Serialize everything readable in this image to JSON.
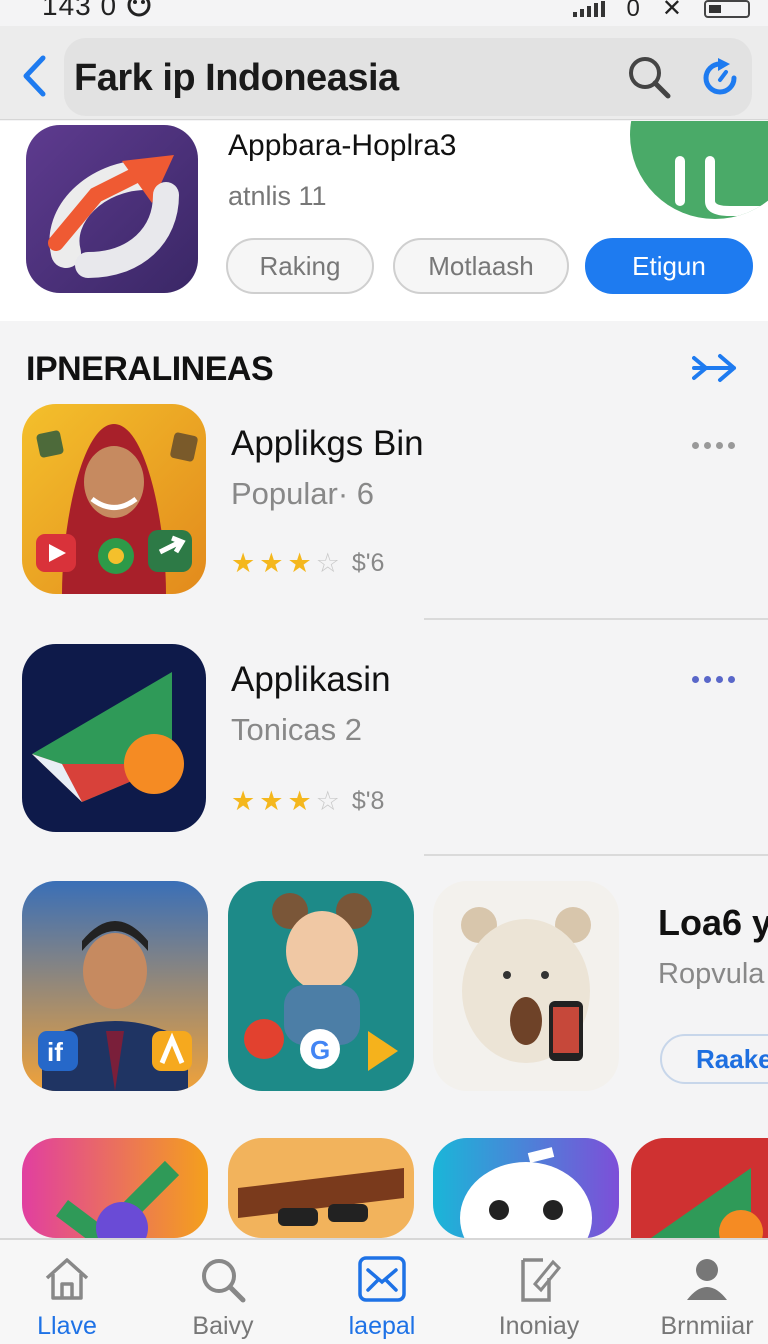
{
  "status_bar": {
    "time": "143 0",
    "carrier_icon": "face-icon",
    "network_text": "0"
  },
  "nav": {
    "title": "Fark ip Indoneasia",
    "back_icon": "chevron-left-icon",
    "search_icon": "search-icon",
    "update_icon": "refresh-icon"
  },
  "featured": {
    "name": "Appbara-Hoplra3",
    "subtitle": "atnlis 11",
    "buttons": [
      "Raking",
      "Motlaash",
      "Etigun"
    ]
  },
  "section": {
    "title": "IPNERALINEAS",
    "arrow_icon": "arrow-right-icon"
  },
  "apps": [
    {
      "name": "Applikgs Bin",
      "subtitle": "Popular· 6",
      "rating": 3,
      "price": "$'6"
    },
    {
      "name": "Applikasin",
      "subtitle": "Tonicas 2",
      "rating": 3,
      "price": "$'8"
    }
  ],
  "grid_side": {
    "title": "Loa6 y",
    "subtitle": "Ropvula",
    "button": "Raake"
  },
  "tabs": [
    {
      "label": "Llave",
      "icon": "home-icon"
    },
    {
      "label": "Baivy",
      "icon": "search-icon"
    },
    {
      "label": "laepal",
      "icon": "apps-icon"
    },
    {
      "label": "Inoniay",
      "icon": "updates-icon"
    },
    {
      "label": "Brnmiiar",
      "icon": "profile-icon"
    }
  ],
  "colors": {
    "accent": "#1e7bf0",
    "green": "#4aaa68",
    "star": "#f4b71d"
  }
}
